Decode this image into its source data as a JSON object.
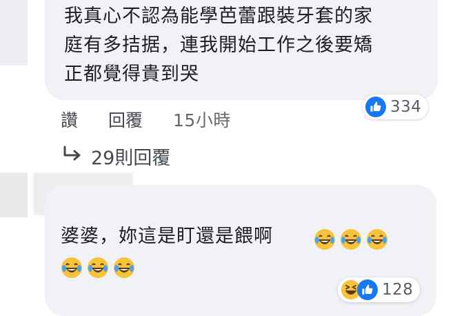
{
  "comment_1": {
    "lines": [
      "我真心不認為能學芭蕾跟裝牙套的家",
      "庭有多拮据，連我開始工作之後要矯",
      "正都覺得貴到哭"
    ],
    "reaction_count": "334",
    "actions": {
      "like": "讚",
      "reply": "回覆",
      "time": "15小時"
    },
    "replies_link": "29則回覆"
  },
  "comment_2": {
    "text": "婆婆，妳這是盯還是餵啊",
    "emoji_line_1": [
      "laugh-cry-emoji",
      "laugh-cry-emoji",
      "laugh-cry-emoji"
    ],
    "emoji_line_2": [
      "laugh-cry-emoji",
      "laugh-cry-emoji",
      "laugh-cry-emoji"
    ],
    "reaction_count": "128"
  },
  "colors": {
    "bubble": "#f0f2f5",
    "like_blue": "#1877f2",
    "emoji_yellow": "#f7c33b",
    "tear_blue": "#4aa3f0",
    "text": "#1c1e21",
    "muted": "#65676b"
  }
}
